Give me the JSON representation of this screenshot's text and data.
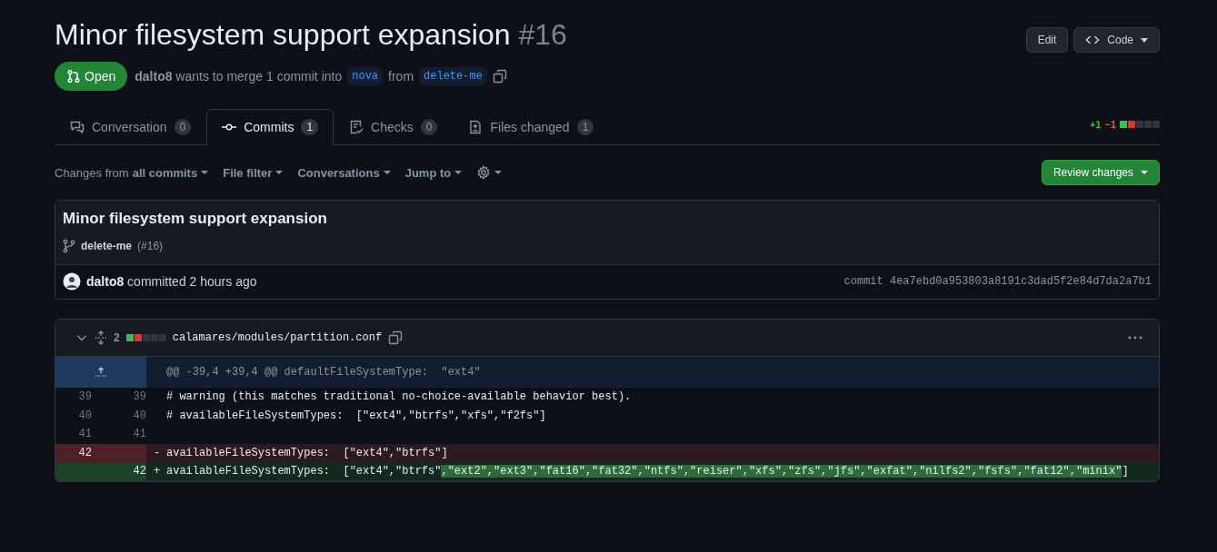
{
  "header": {
    "title": "Minor filesystem support expansion",
    "number": "#16",
    "buttons": [
      {
        "label": "Edit",
        "kind": "plain"
      },
      {
        "label": "Code",
        "kind": "code"
      }
    ]
  },
  "state": {
    "label": "Open",
    "author": "dalto8",
    "text": "wants to merge 1 commit into",
    "base": "nova",
    "from": "from",
    "head": "delete-me"
  },
  "tabs": [
    {
      "label": "Conversation",
      "count": "0",
      "kind": "conversation",
      "selected": false
    },
    {
      "label": "Commits",
      "count": "1",
      "kind": "commits",
      "selected": true
    },
    {
      "label": "Checks",
      "count": "0",
      "kind": "checks",
      "selected": false
    },
    {
      "label": "Files changed",
      "count": "1",
      "kind": "files",
      "selected": false
    }
  ],
  "diffstat": {
    "added": "+1",
    "removed": "−1",
    "blocks": [
      {
        "color": "#3fb950"
      },
      {
        "color": "#da3633"
      },
      {
        "color": "#30363d"
      },
      {
        "color": "#30363d"
      },
      {
        "color": "#30363d"
      }
    ]
  },
  "toolbar": {
    "changes_prefix": "Changes from",
    "changes_value": "all commits",
    "menus": [
      "File filter",
      "Conversations",
      "Jump to"
    ],
    "review": "Review changes"
  },
  "commit": {
    "title": "Minor filesystem support expansion",
    "branch": "delete-me",
    "pr": "(#16)",
    "author": "dalto8",
    "text": "committed 2 hours ago",
    "sha": "commit 4ea7ebd0a953803a8191c3dad5f2e84d7da2a7b1"
  },
  "file": {
    "changes": "2",
    "blocks": [
      {
        "color": "#3fb950"
      },
      {
        "color": "#da3633"
      },
      {
        "color": "#30363d"
      },
      {
        "color": "#30363d"
      },
      {
        "color": "#30363d"
      }
    ],
    "path": "calamares/modules/partition.conf",
    "lines": [
      {
        "kind": "hunk",
        "text": "@@ -39,4 +39,4 @@ defaultFileSystemType:  \"ext4\""
      },
      {
        "kind": "context",
        "old": "39",
        "new": "39",
        "text": "# warning (this matches traditional no-choice-available behavior best)."
      },
      {
        "kind": "context",
        "old": "40",
        "new": "40",
        "text": "# availableFileSystemTypes:  [\"ext4\",\"btrfs\",\"xfs\",\"f2fs\"]"
      },
      {
        "kind": "context",
        "old": "41",
        "new": "41"
      },
      {
        "kind": "deletion",
        "old": "42",
        "sign": "-",
        "text": "availableFileSystemTypes:  [\"ext4\",\"btrfs\"]"
      },
      {
        "kind": "addition",
        "new": "42",
        "sign": "+",
        "text": "availableFileSystemTypes:  [\"ext4\",\"btrfs\"",
        "highlight": ",\"ext2\",\"ext3\",\"fat16\",\"fat32\",\"ntfs\",\"reiser\",\"xfs\",\"zfs\",\"jfs\",\"exfat\",\"nilfs2\",\"fsfs\",\"fat12\",\"minix\"",
        "tail": "]"
      }
    ]
  }
}
